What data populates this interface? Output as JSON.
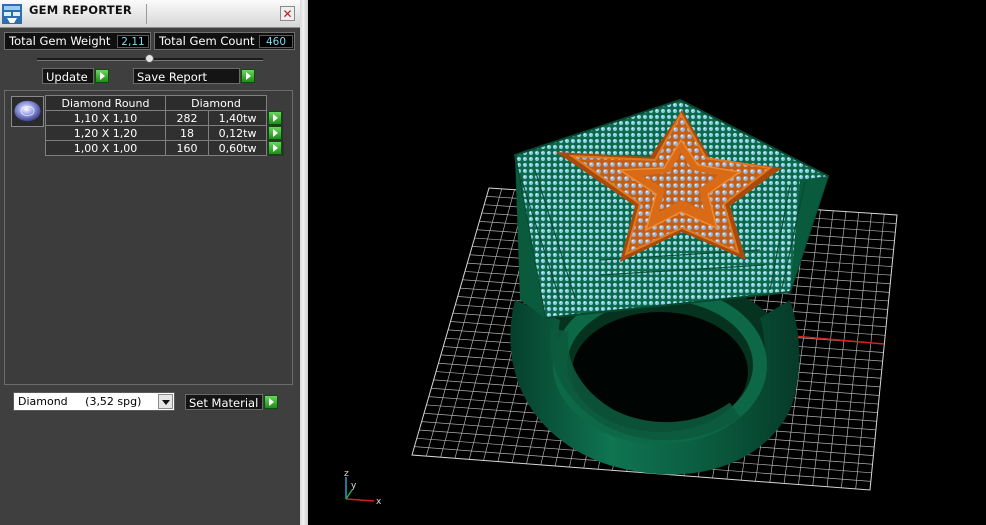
{
  "panel": {
    "title": "GEM REPORTER",
    "close_label": "✕",
    "total_weight_label": "Total Gem Weight",
    "total_weight_value": "2,11",
    "total_count_label": "Total Gem Count",
    "total_count_value": "460",
    "update_label": "Update",
    "save_report_label": "Save Report",
    "table": {
      "headers": [
        "Diamond Round",
        "Diamond"
      ],
      "rows": [
        {
          "size": "1,10 X 1,10",
          "count": "282",
          "weight": "1,40tw"
        },
        {
          "size": "1,20 X 1,20",
          "count": "18",
          "weight": "0,12tw"
        },
        {
          "size": "1,00 X 1,00",
          "count": "160",
          "weight": "0,60tw"
        }
      ]
    },
    "material_value": "Diamond     (3,52 spg)",
    "set_material_label": "Set Material"
  },
  "viewport": {
    "axis_labels": {
      "z": "z",
      "y": "y",
      "x": "x"
    },
    "colors": {
      "ring_band": "#0b5e42",
      "star": "#d96a16",
      "gems": "#7ec6d8",
      "grid": "#d8d8d8",
      "axis_x": "#d42020",
      "axis_y": "#2aa0c8"
    }
  },
  "icons": [
    "app-icon",
    "close-icon",
    "play-icon",
    "dropdown-arrow-icon",
    "gem-thumbnail-icon"
  ]
}
